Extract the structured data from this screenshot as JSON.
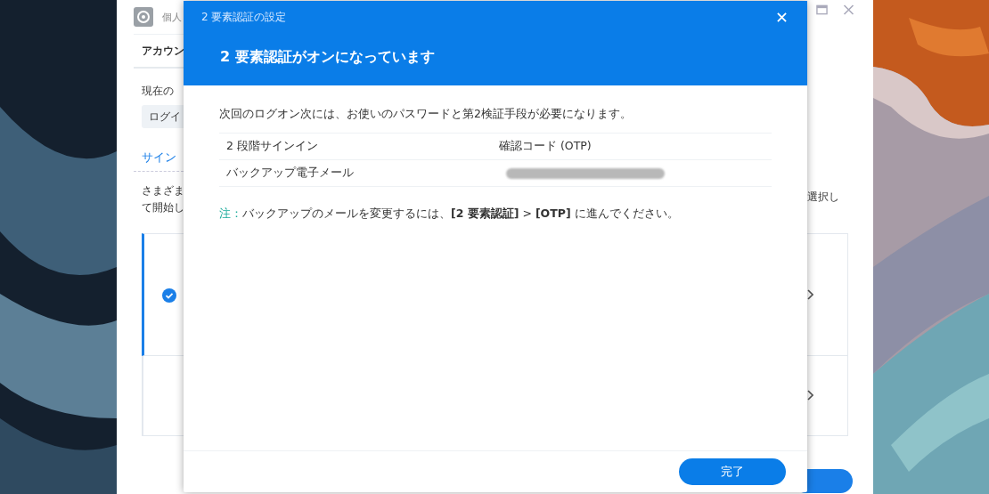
{
  "background_window": {
    "title": "個人",
    "tab": "アカウン",
    "section_label": "現在の",
    "login_button": "ログイ",
    "section_heading": "サイン",
    "description_lines": [
      "さまざま",
      "て開始し"
    ],
    "description_right": "選択し",
    "options": [
      {
        "selected": true
      },
      {
        "selected": false
      }
    ]
  },
  "dialog": {
    "title": "2 要素認証の設定",
    "heading": "2 要素認証がオンになっています",
    "message": "次回のログオン次には、お使いのパスワードと第2検証手段が必要になります。",
    "rows": [
      {
        "kind": "text",
        "label": "2 段階サインイン",
        "value": "確認コード (OTP)"
      },
      {
        "kind": "redacted",
        "label": "バックアップ電子メール"
      }
    ],
    "note_label": "注：",
    "note": "バックアップのメールを変更するには、**[2 要素認証]** > **[OTP]** に進んでください。",
    "button": "完了"
  }
}
